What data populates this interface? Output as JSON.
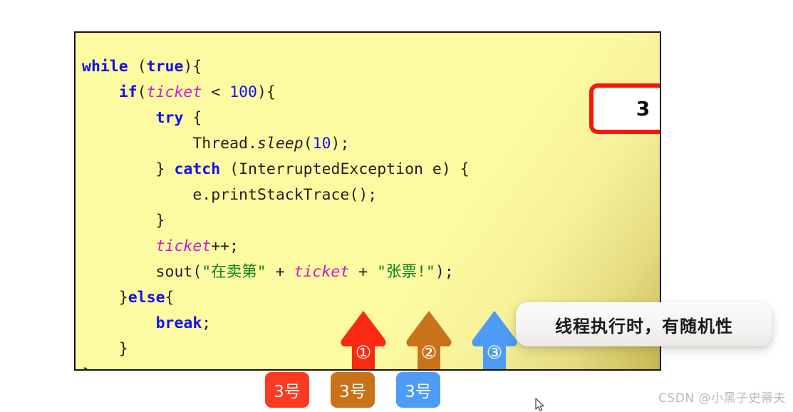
{
  "slide": {
    "background_color": "#ffffff",
    "panel_color": "#fcfba2",
    "panel_border_color": "#1a1408"
  },
  "code": {
    "language": "java",
    "lines": [
      [
        {
          "t": "while",
          "c": "kw"
        },
        {
          "t": " (",
          "c": "pl"
        },
        {
          "t": "true",
          "c": "kw"
        },
        {
          "t": "){",
          "c": "pl"
        }
      ],
      [
        {
          "t": "    ",
          "c": "pl"
        },
        {
          "t": "if",
          "c": "kw"
        },
        {
          "t": "(",
          "c": "pl"
        },
        {
          "t": "ticket",
          "c": "var"
        },
        {
          "t": " < ",
          "c": "pl"
        },
        {
          "t": "100",
          "c": "num"
        },
        {
          "t": "){",
          "c": "pl"
        }
      ],
      [
        {
          "t": "        ",
          "c": "pl"
        },
        {
          "t": "try",
          "c": "kw"
        },
        {
          "t": " {",
          "c": "pl"
        }
      ],
      [
        {
          "t": "            Thread.",
          "c": "pl"
        },
        {
          "t": "sleep",
          "c": "mth"
        },
        {
          "t": "(",
          "c": "pl"
        },
        {
          "t": "10",
          "c": "num"
        },
        {
          "t": ");",
          "c": "pl"
        }
      ],
      [
        {
          "t": "        } ",
          "c": "pl"
        },
        {
          "t": "catch",
          "c": "kw"
        },
        {
          "t": " (InterruptedException e) {",
          "c": "pl"
        }
      ],
      [
        {
          "t": "            e.printStackTrace();",
          "c": "pl"
        }
      ],
      [
        {
          "t": "        }",
          "c": "pl"
        }
      ],
      [
        {
          "t": "        ",
          "c": "pl"
        },
        {
          "t": "ticket",
          "c": "var"
        },
        {
          "t": "++;",
          "c": "pl"
        }
      ],
      [
        {
          "t": "        sout(",
          "c": "pl"
        },
        {
          "t": "\"在卖第\"",
          "c": "str"
        },
        {
          "t": " + ",
          "c": "pl"
        },
        {
          "t": "ticket",
          "c": "var"
        },
        {
          "t": " + ",
          "c": "pl"
        },
        {
          "t": "\"张票!\"",
          "c": "str"
        },
        {
          "t": ");",
          "c": "pl"
        }
      ],
      [
        {
          "t": "    }",
          "c": "pl"
        },
        {
          "t": "else",
          "c": "kw"
        },
        {
          "t": "{",
          "c": "pl"
        }
      ],
      [
        {
          "t": "        ",
          "c": "pl"
        },
        {
          "t": "break",
          "c": "kw"
        },
        {
          "t": ";",
          "c": "pl"
        }
      ],
      [
        {
          "t": "    }",
          "c": "pl"
        }
      ],
      [
        {
          "t": "}",
          "c": "pl"
        }
      ]
    ]
  },
  "counter": {
    "label": "3",
    "border_color": "#f81706",
    "fill_color": "#ffffff"
  },
  "arrows": [
    {
      "id": "arrow-1",
      "badge": "①",
      "color": "#fa2a12",
      "name": "thread-arrow-1"
    },
    {
      "id": "arrow-2",
      "badge": "②",
      "color": "#c8731a",
      "name": "thread-arrow-2"
    },
    {
      "id": "arrow-3",
      "badge": "③",
      "color": "#4d9bf5",
      "name": "thread-arrow-3"
    }
  ],
  "chips": [
    {
      "label": "3号",
      "color": "#fa3a22"
    },
    {
      "label": "3号",
      "color": "#c8731a"
    },
    {
      "label": "3号",
      "color": "#4d9bf5"
    }
  ],
  "tooltip": {
    "text": "线程执行时，有随机性"
  },
  "watermark": {
    "text": "CSDN @小黑子史蒂夫"
  }
}
